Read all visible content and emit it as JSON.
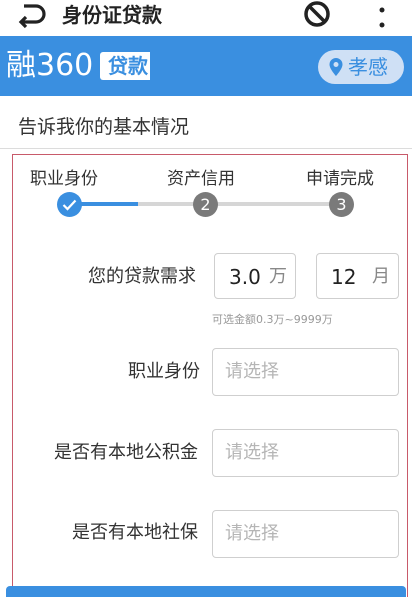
{
  "appbar": {
    "title": "身份证贷款",
    "icons": [
      "back-icon",
      "block-icon",
      "more-icon"
    ]
  },
  "brand": {
    "name": "融360",
    "tag": "贷款",
    "city": "孝感",
    "color": "#3a8fe0"
  },
  "section": {
    "title": "告诉我你的基本情况"
  },
  "steps": {
    "current": 1,
    "items": [
      {
        "label": "职业身份",
        "number": "1"
      },
      {
        "label": "资产信用",
        "number": "2"
      },
      {
        "label": "申请完成",
        "number": "3"
      }
    ]
  },
  "form": {
    "loan": {
      "label": "您的贷款需求",
      "amount": "3.0",
      "amount_unit": "万",
      "months": "12",
      "months_unit": "月",
      "hint": "可选金额0.3万~9999万"
    },
    "occupation": {
      "label": "职业身份",
      "placeholder": "请选择"
    },
    "fund": {
      "label": "是否有本地公积金",
      "placeholder": "请选择"
    },
    "insurance": {
      "label": "是否有本地社保",
      "placeholder": "请选择"
    }
  }
}
